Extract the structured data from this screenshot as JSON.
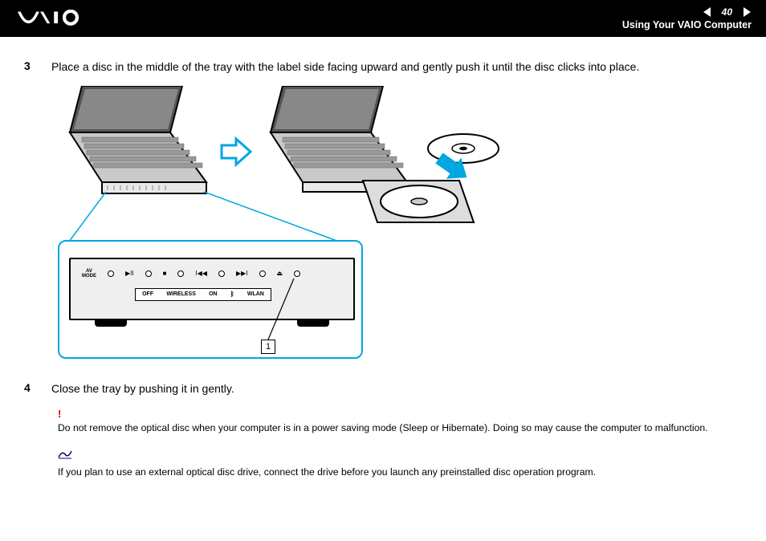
{
  "header": {
    "page_number": "40",
    "section_title": "Using Your VAIO Computer"
  },
  "steps": {
    "s3": {
      "num": "3",
      "text": "Place a disc in the middle of the tray with the label side facing upward and gently push it until the disc clicks into place."
    },
    "s4": {
      "num": "4",
      "text": "Close the tray by pushing it in gently."
    }
  },
  "panel": {
    "av_mode_top": "AV",
    "av_mode_bottom": "MODE",
    "wireless_off": "OFF",
    "wireless_label": "WIRELESS",
    "wireless_on": "ON",
    "wlan": "WLAN",
    "callout_label": "1"
  },
  "notes": {
    "warning_text": "Do not remove the optical disc when your computer is in a power saving mode (Sleep or Hibernate). Doing so may cause the computer to malfunction.",
    "tip_text": "If you plan to use an external optical disc drive, connect the drive before you launch any preinstalled disc operation program."
  }
}
